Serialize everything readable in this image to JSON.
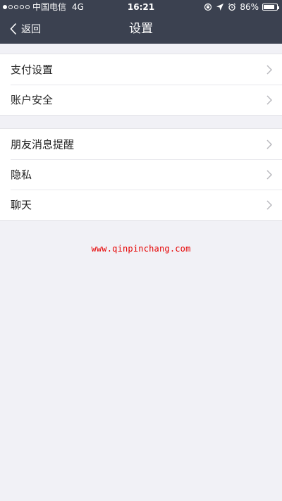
{
  "status_bar": {
    "carrier": "中国电信",
    "network": "4G",
    "time": "16:21",
    "battery": "86%",
    "battery_level": 0.86
  },
  "nav": {
    "back_label": "返回",
    "title": "设置"
  },
  "groups": [
    {
      "items": [
        {
          "label": "支付设置"
        },
        {
          "label": "账户安全"
        }
      ]
    },
    {
      "items": [
        {
          "label": "朋友消息提醒"
        },
        {
          "label": "隐私"
        },
        {
          "label": "聊天"
        }
      ]
    }
  ],
  "watermark": "www.qinpinchang.com",
  "colors": {
    "header_bg": "#3b4150",
    "page_bg": "#f1f1f6",
    "watermark": "#e60000"
  }
}
